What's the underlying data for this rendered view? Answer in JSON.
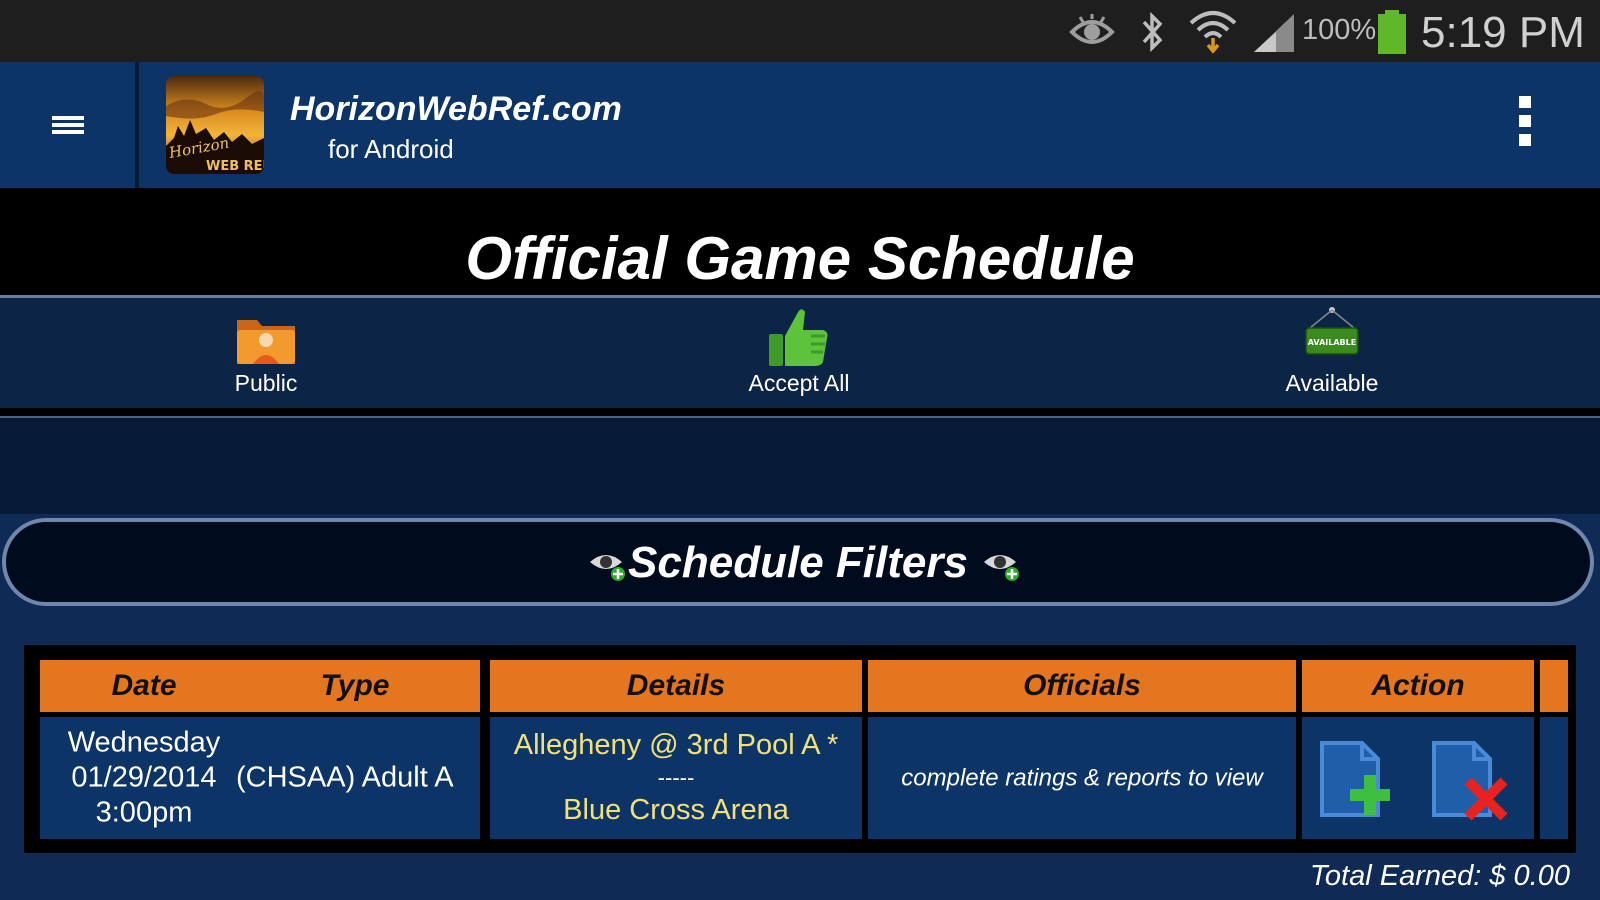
{
  "status_bar": {
    "battery_percent": "100%",
    "time": "5:19 PM",
    "icons": [
      "eye-icon",
      "bluetooth-icon",
      "wifi-icon",
      "signal-icon",
      "battery-icon"
    ]
  },
  "action_bar": {
    "app_title": "HorizonWebRef.com",
    "app_subtitle": "for Android",
    "logo_text": [
      "Horizon",
      "WEB REF"
    ]
  },
  "page": {
    "title": "Official Game Schedule"
  },
  "toolbar": {
    "items": [
      {
        "label": "Public",
        "icon": "public-folder-icon"
      },
      {
        "label": "Accept All",
        "icon": "thumbs-up-icon"
      },
      {
        "label": "Available",
        "icon": "available-sign-icon",
        "sign_text": "AVAILABLE"
      }
    ]
  },
  "filters": {
    "label": "Schedule Filters"
  },
  "schedule": {
    "columns": [
      "Date",
      "Type",
      "Details",
      "Officials",
      "Action"
    ],
    "rows": [
      {
        "date_day": "Wednesday",
        "date": "01/29/2014",
        "time": "3:00pm",
        "type": "(CHSAA) Adult A",
        "details_line1": "Allegheny @ 3rd Pool A *",
        "details_line2": "-----",
        "details_line3": "Blue Cross Arena",
        "officials": "complete ratings & reports to view",
        "actions": [
          "add-document-icon",
          "remove-document-icon"
        ]
      }
    ]
  },
  "footer": {
    "total_earned": "Total Earned: $ 0.00"
  },
  "colors": {
    "header_blue": "#0d3466",
    "table_header_orange": "#e57620",
    "details_yellow": "#f2e17a"
  }
}
